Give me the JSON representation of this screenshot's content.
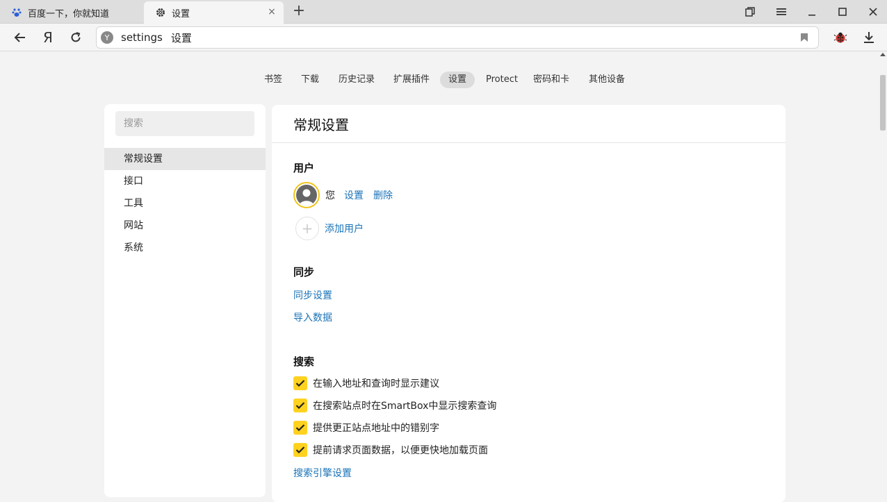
{
  "tabs": [
    {
      "title": "百度一下，你就知道",
      "icon": "baidu-paw-icon"
    },
    {
      "title": "设置",
      "icon": "gear-icon"
    }
  ],
  "toolbar": {
    "yandex_letter": "Я",
    "url": "settings",
    "page_title": "设置",
    "site_icon_letter": "Y"
  },
  "topnav": [
    "书签",
    "下载",
    "历史记录",
    "扩展插件",
    "设置",
    "Protect",
    "密码和卡",
    "其他设备"
  ],
  "sidebar": {
    "search_placeholder": "搜索",
    "items": [
      "常规设置",
      "接口",
      "工具",
      "网站",
      "系统"
    ]
  },
  "main": {
    "title": "常规设置",
    "users": {
      "heading": "用户",
      "current_user": "您",
      "settings_link": "设置",
      "delete_link": "删除",
      "add_user": "添加用户"
    },
    "sync": {
      "heading": "同步",
      "settings_link": "同步设置",
      "import_link": "导入数据"
    },
    "search": {
      "heading": "搜索",
      "options": [
        {
          "label": "在输入地址和查询时显示建议",
          "checked": true
        },
        {
          "label": "在搜索站点时在SmartBox中显示搜索查询",
          "checked": true
        },
        {
          "label": "提供更正站点地址中的错别字",
          "checked": true
        },
        {
          "label": "提前请求页面数据，以便更快地加载页面",
          "checked": true
        }
      ],
      "engine_link": "搜索引擎设置"
    }
  },
  "colors": {
    "accent": "#ffd21f",
    "link": "#1a73b8"
  }
}
